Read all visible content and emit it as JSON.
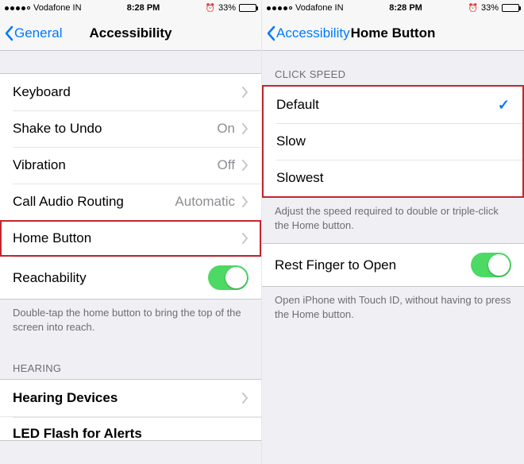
{
  "status": {
    "carrier": "Vodafone IN",
    "time": "8:28 PM",
    "battery_pct": "33%"
  },
  "left": {
    "back_label": "General",
    "title": "Accessibility",
    "rows": {
      "keyboard": "Keyboard",
      "shake": "Shake to Undo",
      "shake_val": "On",
      "vibration": "Vibration",
      "vibration_val": "Off",
      "car": "Call Audio Routing",
      "car_val": "Automatic",
      "home": "Home Button",
      "reach": "Reachability"
    },
    "reach_note": "Double-tap the home button to bring the top of the screen into reach.",
    "hearing_header": "HEARING",
    "hearing_devices": "Hearing Devices",
    "led_partial": "LED Flash for Alerts"
  },
  "right": {
    "back_label": "Accessibility",
    "title": "Home Button",
    "click_speed_header": "CLICK SPEED",
    "options": {
      "default": "Default",
      "slow": "Slow",
      "slowest": "Slowest"
    },
    "speed_note": "Adjust the speed required to double or triple-click the Home button.",
    "rest_finger": "Rest Finger to Open",
    "rest_note": "Open iPhone with Touch ID, without having to press the Home button."
  }
}
